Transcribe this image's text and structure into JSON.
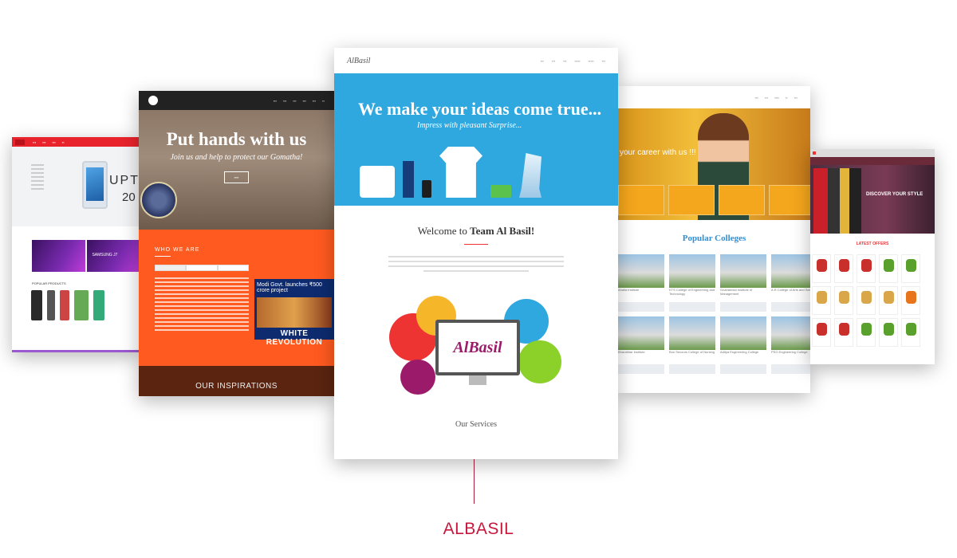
{
  "card2": {
    "title": "Put hands with us",
    "subtitle": "Join us and help to protect our Gomatha!",
    "who_heading": "WHO WE ARE",
    "news_headline": "Modi Govt. launches ₹500 crore project",
    "news_banner": "WHITE REVOLUTION",
    "footer_heading": "OUR INSPIRATIONS"
  },
  "card3": {
    "logo": "AlBasil",
    "hero_title": "We make your ideas come true...",
    "hero_subtitle": "Impress with pleasant Surprise...",
    "welcome_prefix": "Welcome to ",
    "welcome_brand": "Team Al Basil!",
    "monitor_logo": "AlBasil",
    "services_heading": "Our Services"
  },
  "card1": {
    "hero_text_1": "UPT",
    "hero_text_2": "20",
    "banner_label": "SAMSUNG J7",
    "products_heading": "POPULAR PRODUCTS"
  },
  "card4": {
    "hero_text": "your career with us !!!",
    "section_title": "Popular Colleges",
    "college_names": [
      "Ahalia Institute",
      "KTS College of Engineering and Technology",
      "Gnanamani Institute of Management",
      "A.R College of Arts and Science",
      "Bharathiar Institute",
      "Bon Secours College of Nursing",
      "Aditya Engineering College",
      "PSG Engineering College"
    ]
  },
  "card5": {
    "hero_text": "DISCOVER YOUR STYLE",
    "section_title": "LATEST OFFERS"
  },
  "caption": "ALBASIL",
  "colors": {
    "accent": "#c8173c",
    "albasil_blue": "#2fa7df",
    "temple_orange": "#ff5a1f",
    "college_orange": "#f4a61c"
  }
}
